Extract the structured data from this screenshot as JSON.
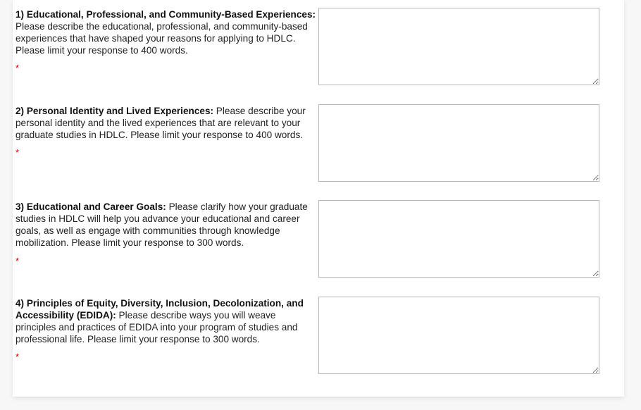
{
  "questions": [
    {
      "title": "1) Educational, Professional, and Community-Based Experiences:",
      "body": " Please describe the educational, professional, and community-based experiences that have shaped your reasons for applying to HDLC. Please limit your response to 400 words.",
      "required_marker": "*",
      "answer_value": ""
    },
    {
      "title": "2) Personal Identity and Lived Experiences:",
      "body": " Please describe your personal identity and the lived experiences that are relevant to your graduate studies in HDLC. Please limit your response to 400 words.",
      "required_marker": "*",
      "answer_value": ""
    },
    {
      "title": "3) Educational and Career Goals:",
      "body": " Please clarify how your graduate studies in HDLC will help you advance your educational and career goals, as well as engage with communities through knowledge mobilization. Please limit your response to 300 words.",
      "required_marker": "*",
      "answer_value": ""
    },
    {
      "title": "4) Principles of Equity, Diversity, Inclusion, Decolonization, and Accessibility (EDIDA):",
      "body": " Please describe ways you will weave principles and practices of EDIDA into your program of studies and professional life. Please limit your response to 300 words.",
      "required_marker": "*",
      "answer_value": ""
    }
  ],
  "colors": {
    "required": "#e00000",
    "border": "#b7b7b7"
  }
}
